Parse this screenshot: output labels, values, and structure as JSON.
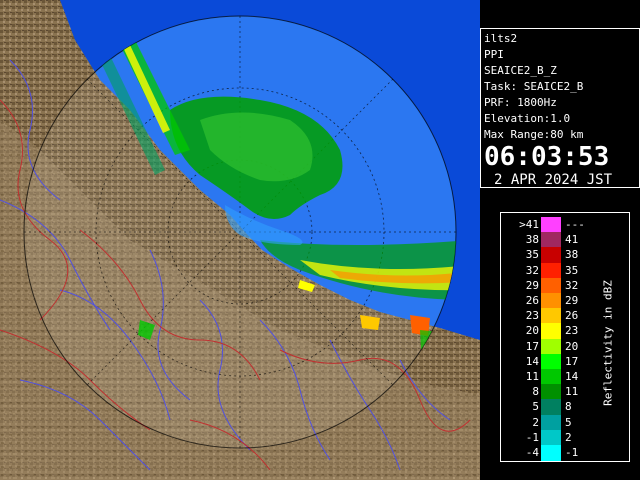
{
  "info": {
    "radar_name": "ilts2",
    "scan_type": "PPI",
    "product": "SEAICE2_B_Z",
    "task": "Task: SEAICE2_B",
    "prf": "PRF: 1800Hz",
    "elevation": "Elevation:1.0",
    "max_range": "Max Range:80 km",
    "time": "06:03:53",
    "date": "2 APR 2024 JST"
  },
  "legend": {
    "unit_label": "Reflectivity in dBZ",
    "rows": [
      {
        "low": ">41",
        "high": "---",
        "color": "#ff40ff"
      },
      {
        "low": "38",
        "high": "41",
        "color": "#a02860"
      },
      {
        "low": "35",
        "high": "38",
        "color": "#c80000"
      },
      {
        "low": "32",
        "high": "35",
        "color": "#ff2000"
      },
      {
        "low": "29",
        "high": "32",
        "color": "#ff6000"
      },
      {
        "low": "26",
        "high": "29",
        "color": "#ff9000"
      },
      {
        "low": "23",
        "high": "26",
        "color": "#ffc800"
      },
      {
        "low": "20",
        "high": "23",
        "color": "#ffff00"
      },
      {
        "low": "17",
        "high": "20",
        "color": "#a0ff00"
      },
      {
        "low": "14",
        "high": "17",
        "color": "#00ff00"
      },
      {
        "low": "11",
        "high": "14",
        "color": "#00c800"
      },
      {
        "low": "8",
        "high": "11",
        "color": "#009000"
      },
      {
        "low": "5",
        "high": "8",
        "color": "#008060"
      },
      {
        "low": "2",
        "high": "5",
        "color": "#00a0a0"
      },
      {
        "low": "-1",
        "high": "2",
        "color": "#00c8c8"
      },
      {
        "low": "-4",
        "high": "-1",
        "color": "#00ffff"
      }
    ]
  },
  "map": {
    "sea_color": "#0a4ad8",
    "range_sea_color": "#1a6cf0",
    "land_color": "#8a7350",
    "river_color": "#5050e0",
    "border_color": "#c03030"
  }
}
